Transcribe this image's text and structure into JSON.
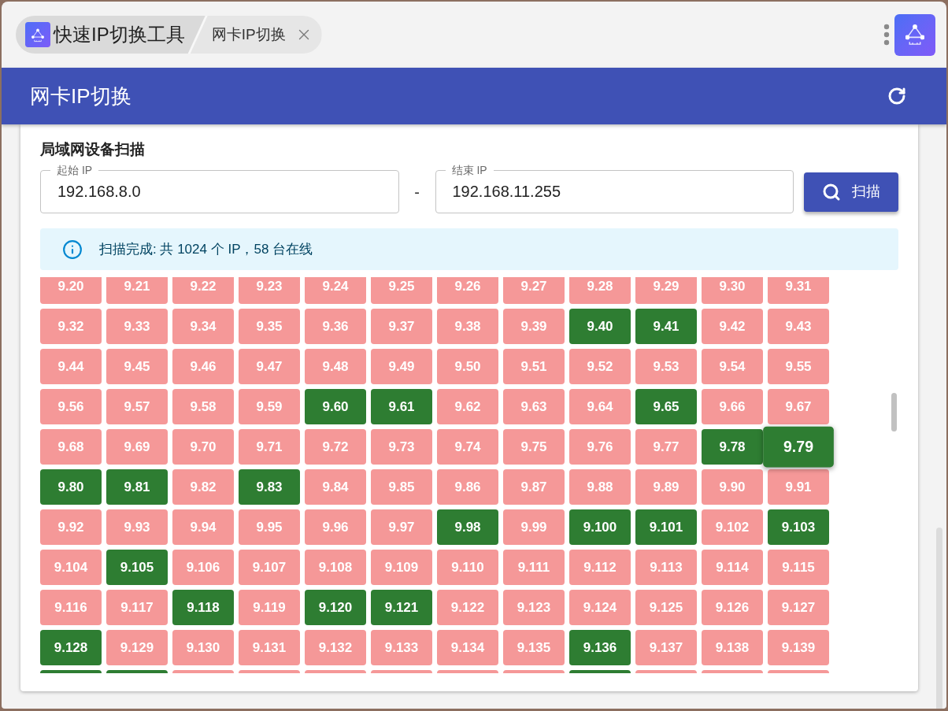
{
  "title_bar": {
    "app_name": "快速IP切换工具",
    "open_tab": "网卡IP切换"
  },
  "header": {
    "title": "网卡IP切换"
  },
  "scan_panel": {
    "heading": "局域网设备扫描",
    "start_ip": {
      "label": "起始 IP",
      "value": "192.168.8.0"
    },
    "range_separator": "-",
    "end_ip": {
      "label": "结束 IP",
      "value": "192.168.11.255"
    },
    "scan_button": "扫描",
    "status": "扫描完成: 共 1024 个 IP，58 台在线",
    "hosts": [
      {
        "label": "9.20",
        "online": false,
        "hovered": false
      },
      {
        "label": "9.21",
        "online": false,
        "hovered": false
      },
      {
        "label": "9.22",
        "online": false,
        "hovered": false
      },
      {
        "label": "9.23",
        "online": false,
        "hovered": false
      },
      {
        "label": "9.24",
        "online": false,
        "hovered": false
      },
      {
        "label": "9.25",
        "online": false,
        "hovered": false
      },
      {
        "label": "9.26",
        "online": false,
        "hovered": false
      },
      {
        "label": "9.27",
        "online": false,
        "hovered": false
      },
      {
        "label": "9.28",
        "online": false,
        "hovered": false
      },
      {
        "label": "9.29",
        "online": false,
        "hovered": false
      },
      {
        "label": "9.30",
        "online": false,
        "hovered": false
      },
      {
        "label": "9.31",
        "online": false,
        "hovered": false
      },
      {
        "label": "9.32",
        "online": false,
        "hovered": false
      },
      {
        "label": "9.33",
        "online": false,
        "hovered": false
      },
      {
        "label": "9.34",
        "online": false,
        "hovered": false
      },
      {
        "label": "9.35",
        "online": false,
        "hovered": false
      },
      {
        "label": "9.36",
        "online": false,
        "hovered": false
      },
      {
        "label": "9.37",
        "online": false,
        "hovered": false
      },
      {
        "label": "9.38",
        "online": false,
        "hovered": false
      },
      {
        "label": "9.39",
        "online": false,
        "hovered": false
      },
      {
        "label": "9.40",
        "online": true,
        "hovered": false
      },
      {
        "label": "9.41",
        "online": true,
        "hovered": false
      },
      {
        "label": "9.42",
        "online": false,
        "hovered": false
      },
      {
        "label": "9.43",
        "online": false,
        "hovered": false
      },
      {
        "label": "9.44",
        "online": false,
        "hovered": false
      },
      {
        "label": "9.45",
        "online": false,
        "hovered": false
      },
      {
        "label": "9.46",
        "online": false,
        "hovered": false
      },
      {
        "label": "9.47",
        "online": false,
        "hovered": false
      },
      {
        "label": "9.48",
        "online": false,
        "hovered": false
      },
      {
        "label": "9.49",
        "online": false,
        "hovered": false
      },
      {
        "label": "9.50",
        "online": false,
        "hovered": false
      },
      {
        "label": "9.51",
        "online": false,
        "hovered": false
      },
      {
        "label": "9.52",
        "online": false,
        "hovered": false
      },
      {
        "label": "9.53",
        "online": false,
        "hovered": false
      },
      {
        "label": "9.54",
        "online": false,
        "hovered": false
      },
      {
        "label": "9.55",
        "online": false,
        "hovered": false
      },
      {
        "label": "9.56",
        "online": false,
        "hovered": false
      },
      {
        "label": "9.57",
        "online": false,
        "hovered": false
      },
      {
        "label": "9.58",
        "online": false,
        "hovered": false
      },
      {
        "label": "9.59",
        "online": false,
        "hovered": false
      },
      {
        "label": "9.60",
        "online": true,
        "hovered": false
      },
      {
        "label": "9.61",
        "online": true,
        "hovered": false
      },
      {
        "label": "9.62",
        "online": false,
        "hovered": false
      },
      {
        "label": "9.63",
        "online": false,
        "hovered": false
      },
      {
        "label": "9.64",
        "online": false,
        "hovered": false
      },
      {
        "label": "9.65",
        "online": true,
        "hovered": false
      },
      {
        "label": "9.66",
        "online": false,
        "hovered": false
      },
      {
        "label": "9.67",
        "online": false,
        "hovered": false
      },
      {
        "label": "9.68",
        "online": false,
        "hovered": false
      },
      {
        "label": "9.69",
        "online": false,
        "hovered": false
      },
      {
        "label": "9.70",
        "online": false,
        "hovered": false
      },
      {
        "label": "9.71",
        "online": false,
        "hovered": false
      },
      {
        "label": "9.72",
        "online": false,
        "hovered": false
      },
      {
        "label": "9.73",
        "online": false,
        "hovered": false
      },
      {
        "label": "9.74",
        "online": false,
        "hovered": false
      },
      {
        "label": "9.75",
        "online": false,
        "hovered": false
      },
      {
        "label": "9.76",
        "online": false,
        "hovered": false
      },
      {
        "label": "9.77",
        "online": false,
        "hovered": false
      },
      {
        "label": "9.78",
        "online": true,
        "hovered": false
      },
      {
        "label": "9.79",
        "online": true,
        "hovered": true
      },
      {
        "label": "9.80",
        "online": true,
        "hovered": false
      },
      {
        "label": "9.81",
        "online": true,
        "hovered": false
      },
      {
        "label": "9.82",
        "online": false,
        "hovered": false
      },
      {
        "label": "9.83",
        "online": true,
        "hovered": false
      },
      {
        "label": "9.84",
        "online": false,
        "hovered": false
      },
      {
        "label": "9.85",
        "online": false,
        "hovered": false
      },
      {
        "label": "9.86",
        "online": false,
        "hovered": false
      },
      {
        "label": "9.87",
        "online": false,
        "hovered": false
      },
      {
        "label": "9.88",
        "online": false,
        "hovered": false
      },
      {
        "label": "9.89",
        "online": false,
        "hovered": false
      },
      {
        "label": "9.90",
        "online": false,
        "hovered": false
      },
      {
        "label": "9.91",
        "online": false,
        "hovered": false
      },
      {
        "label": "9.92",
        "online": false,
        "hovered": false
      },
      {
        "label": "9.93",
        "online": false,
        "hovered": false
      },
      {
        "label": "9.94",
        "online": false,
        "hovered": false
      },
      {
        "label": "9.95",
        "online": false,
        "hovered": false
      },
      {
        "label": "9.96",
        "online": false,
        "hovered": false
      },
      {
        "label": "9.97",
        "online": false,
        "hovered": false
      },
      {
        "label": "9.98",
        "online": true,
        "hovered": false
      },
      {
        "label": "9.99",
        "online": false,
        "hovered": false
      },
      {
        "label": "9.100",
        "online": true,
        "hovered": false
      },
      {
        "label": "9.101",
        "online": true,
        "hovered": false
      },
      {
        "label": "9.102",
        "online": false,
        "hovered": false
      },
      {
        "label": "9.103",
        "online": true,
        "hovered": false
      },
      {
        "label": "9.104",
        "online": false,
        "hovered": false
      },
      {
        "label": "9.105",
        "online": true,
        "hovered": false
      },
      {
        "label": "9.106",
        "online": false,
        "hovered": false
      },
      {
        "label": "9.107",
        "online": false,
        "hovered": false
      },
      {
        "label": "9.108",
        "online": false,
        "hovered": false
      },
      {
        "label": "9.109",
        "online": false,
        "hovered": false
      },
      {
        "label": "9.110",
        "online": false,
        "hovered": false
      },
      {
        "label": "9.111",
        "online": false,
        "hovered": false
      },
      {
        "label": "9.112",
        "online": false,
        "hovered": false
      },
      {
        "label": "9.113",
        "online": false,
        "hovered": false
      },
      {
        "label": "9.114",
        "online": false,
        "hovered": false
      },
      {
        "label": "9.115",
        "online": false,
        "hovered": false
      },
      {
        "label": "9.116",
        "online": false,
        "hovered": false
      },
      {
        "label": "9.117",
        "online": false,
        "hovered": false
      },
      {
        "label": "9.118",
        "online": true,
        "hovered": false
      },
      {
        "label": "9.119",
        "online": false,
        "hovered": false
      },
      {
        "label": "9.120",
        "online": true,
        "hovered": false
      },
      {
        "label": "9.121",
        "online": true,
        "hovered": false
      },
      {
        "label": "9.122",
        "online": false,
        "hovered": false
      },
      {
        "label": "9.123",
        "online": false,
        "hovered": false
      },
      {
        "label": "9.124",
        "online": false,
        "hovered": false
      },
      {
        "label": "9.125",
        "online": false,
        "hovered": false
      },
      {
        "label": "9.126",
        "online": false,
        "hovered": false
      },
      {
        "label": "9.127",
        "online": false,
        "hovered": false
      },
      {
        "label": "9.128",
        "online": true,
        "hovered": false
      },
      {
        "label": "9.129",
        "online": false,
        "hovered": false
      },
      {
        "label": "9.130",
        "online": false,
        "hovered": false
      },
      {
        "label": "9.131",
        "online": false,
        "hovered": false
      },
      {
        "label": "9.132",
        "online": false,
        "hovered": false
      },
      {
        "label": "9.133",
        "online": false,
        "hovered": false
      },
      {
        "label": "9.134",
        "online": false,
        "hovered": false
      },
      {
        "label": "9.135",
        "online": false,
        "hovered": false
      },
      {
        "label": "9.136",
        "online": true,
        "hovered": false
      },
      {
        "label": "9.137",
        "online": false,
        "hovered": false
      },
      {
        "label": "9.138",
        "online": false,
        "hovered": false
      },
      {
        "label": "9.139",
        "online": false,
        "hovered": false
      },
      {
        "online": true,
        "hovered": false
      },
      {
        "online": true,
        "hovered": false
      },
      {
        "online": false,
        "hovered": false
      },
      {
        "online": false,
        "hovered": false
      },
      {
        "online": false,
        "hovered": false
      },
      {
        "online": false,
        "hovered": false
      },
      {
        "online": false,
        "hovered": false
      },
      {
        "online": false,
        "hovered": false
      },
      {
        "online": true,
        "hovered": false
      },
      {
        "online": false,
        "hovered": false
      },
      {
        "online": false,
        "hovered": false
      },
      {
        "online": false,
        "hovered": false
      }
    ]
  }
}
